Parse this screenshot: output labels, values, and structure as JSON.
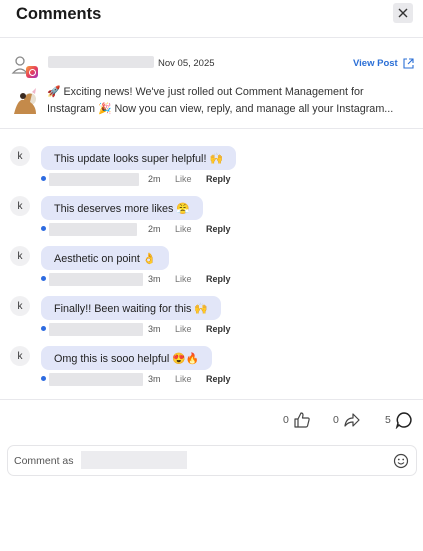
{
  "header": {
    "title": "Comments",
    "close_icon": "close-icon"
  },
  "post": {
    "date": "Nov 05, 2025",
    "view_post_label": "View Post",
    "text_line1": "🚀 Exciting news! We've just rolled out Comment Management for",
    "text_line2": "Instagram 🎉 Now you can view, reply, and manage all your Instagram..."
  },
  "comments": [
    {
      "avatar": "k",
      "text": "This update looks super helpful! 🙌",
      "time": "2m",
      "like": "Like",
      "reply": "Reply"
    },
    {
      "avatar": "k",
      "text": "This deserves more likes 😤",
      "time": "2m",
      "like": "Like",
      "reply": "Reply"
    },
    {
      "avatar": "k",
      "text": "Aesthetic on point 👌",
      "time": "3m",
      "like": "Like",
      "reply": "Reply"
    },
    {
      "avatar": "k",
      "text": "Finally!! Been waiting for this 🙌",
      "time": "3m",
      "like": "Like",
      "reply": "Reply"
    },
    {
      "avatar": "k",
      "text": "Omg this is sooo helpful 😍🔥",
      "time": "3m",
      "like": "Like",
      "reply": "Reply"
    }
  ],
  "stats": {
    "likes": "0",
    "shares": "0",
    "comments": "5"
  },
  "composer": {
    "label": "Comment as"
  },
  "colors": {
    "accent": "#2b6fd6",
    "bubble": "#e2e6f8",
    "dot": "#2d6be0"
  }
}
